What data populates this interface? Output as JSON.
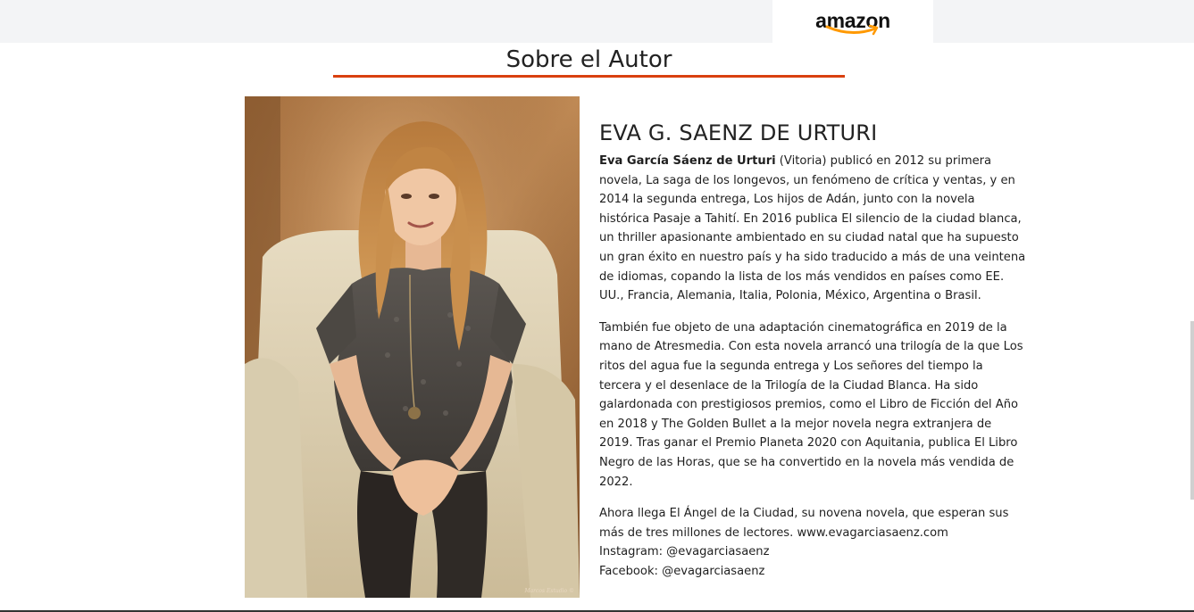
{
  "header": {
    "logo_text": "amazon",
    "brand_color": "#ff9900"
  },
  "section": {
    "title": "Sobre el Autor",
    "rule_color": "#d9400f"
  },
  "photo": {
    "credit": "Marcos Estudio ©",
    "alt": "Eva García Sáenz de Urturi"
  },
  "author": {
    "name": "EVA G. SAENZ DE URTURI",
    "bold_name": "Eva García Sáenz de Urturi",
    "p1_rest": " (Vitoria) publicó en 2012 su primera novela, La saga de los longevos, un fenómeno de crítica y ventas, y en 2014 la segunda entrega, Los hijos de Adán, junto con la novela histórica Pasaje a Tahití. En 2016 publica El silencio de la ciudad blanca, un thriller apasionante ambientado en su ciudad natal que ha supuesto un gran éxito en nuestro país y ha sido traducido a más de una veintena de idiomas, copando la lista de los más vendidos en países como EE. UU., Francia, Alemania, Italia, Polonia, México, Argentina o Brasil.",
    "p2": "También fue objeto de una adaptación cinematográfica en 2019 de la mano de Atresmedia. Con esta novela arrancó una trilogía de la que Los ritos del agua fue la segunda entrega y Los señores del tiempo la tercera y el desenlace de la Trilogía de la Ciudad Blanca. Ha sido galardonada con prestigiosos premios, como el Libro de Ficción del Año en 2018 y The Golden Bullet a la mejor novela negra extranjera de 2019. Tras ganar el Premio Planeta 2020 con Aquitania, publica El Libro Negro de las Horas, que se ha convertido en la novela más vendida de 2022.",
    "p3": "Ahora llega El Ángel de la Ciudad, su novena novela, que esperan sus más de tres millones de lectores. www.evagarciasaenz.com",
    "instagram": "Instagram: @evagarciasaenz",
    "facebook": "Facebook: @evagarciasaenz"
  }
}
